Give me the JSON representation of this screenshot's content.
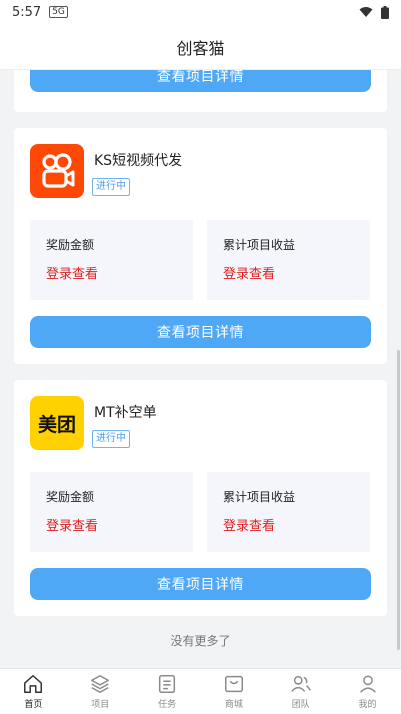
{
  "status": {
    "time": "5:57",
    "sim_label": "5G"
  },
  "header": {
    "title": "创客猫"
  },
  "partial_card": {
    "button_label": "查看项目详情"
  },
  "projects": [
    {
      "name": "KS短视频代发",
      "status": "进行中",
      "logo": "kuaishou-logo",
      "reward_label": "奖励金额",
      "reward_value": "登录查看",
      "income_label": "累计项目收益",
      "income_value": "登录查看",
      "button_label": "查看项目详情"
    },
    {
      "name": "MT补空单",
      "status": "进行中",
      "logo_text": "美团",
      "reward_label": "奖励金额",
      "reward_value": "登录查看",
      "income_label": "累计项目收益",
      "income_value": "登录查看",
      "button_label": "查看项目详情"
    }
  ],
  "footer_note": "没有更多了",
  "tabs": [
    {
      "label": "首页",
      "icon": "home-icon",
      "active": true
    },
    {
      "label": "项目",
      "icon": "layers-icon",
      "active": false
    },
    {
      "label": "任务",
      "icon": "task-list-icon",
      "active": false
    },
    {
      "label": "商城",
      "icon": "mall-icon",
      "active": false
    },
    {
      "label": "团队",
      "icon": "team-icon",
      "active": false
    },
    {
      "label": "我的",
      "icon": "profile-icon",
      "active": false
    }
  ],
  "colors": {
    "accent": "#4fa8f6",
    "highlight": "#e02020",
    "ks_brand": "#fe4906",
    "mt_brand": "#ffd100"
  }
}
